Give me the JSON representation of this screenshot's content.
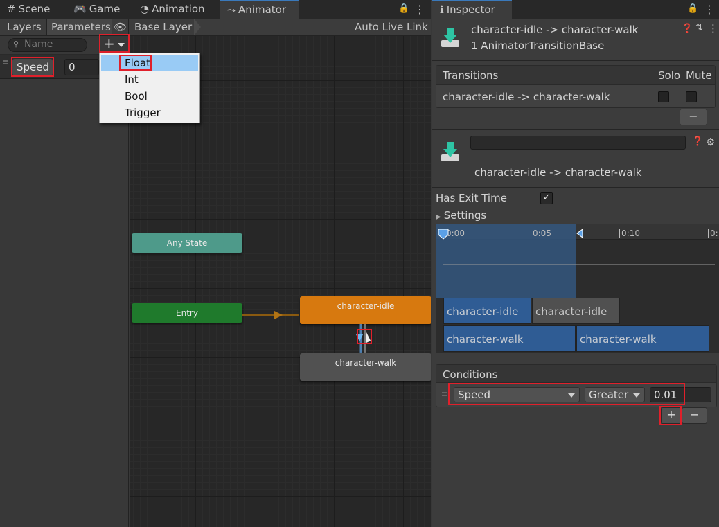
{
  "tabs": [
    {
      "label": "Scene",
      "icon": "grid-icon"
    },
    {
      "label": "Game",
      "icon": "gamepad-icon"
    },
    {
      "label": "Animation",
      "icon": "animation-clock-icon"
    },
    {
      "label": "Animator",
      "icon": "animator-icon"
    }
  ],
  "toolbar": {
    "layers": "Layers",
    "parameters": "Parameters",
    "base_layer": "Base Layer",
    "auto_live_link": "Auto Live Link"
  },
  "params": {
    "search_placeholder": "Name",
    "items": [
      {
        "name": "Speed",
        "value": "0"
      }
    ]
  },
  "add_menu": {
    "items": [
      "Float",
      "Int",
      "Bool",
      "Trigger"
    ]
  },
  "graph": {
    "any_state": "Any State",
    "entry": "Entry",
    "idle": "character-idle",
    "walk": "character-walk"
  },
  "inspector": {
    "tab": "Inspector",
    "title": "character-idle -> character-walk",
    "subtitle": "1 AnimatorTransitionBase",
    "transitions_header": "Transitions",
    "solo": "Solo",
    "mute": "Mute",
    "transition_row": "character-idle -> character-walk",
    "transition_name_field": "",
    "detail_title": "character-idle -> character-walk",
    "has_exit_time": "Has Exit Time",
    "settings": "Settings",
    "timeline_ticks": [
      "0:00",
      "0:05",
      "0:10",
      "0:"
    ],
    "clip_idle_a": "character-idle",
    "clip_idle_b": "character-idle",
    "clip_walk_a": "character-walk",
    "clip_walk_b": "character-walk",
    "conditions_header": "Conditions",
    "condition": {
      "parameter": "Speed",
      "mode": "Greater",
      "value": "0.01"
    }
  },
  "colors": {
    "idle": "#d7790f",
    "entry": "#1f7a2c",
    "any_state": "#4e9a8a",
    "walk": "#515151",
    "highlight": "#e0202b",
    "accent": "#3a79bb"
  }
}
